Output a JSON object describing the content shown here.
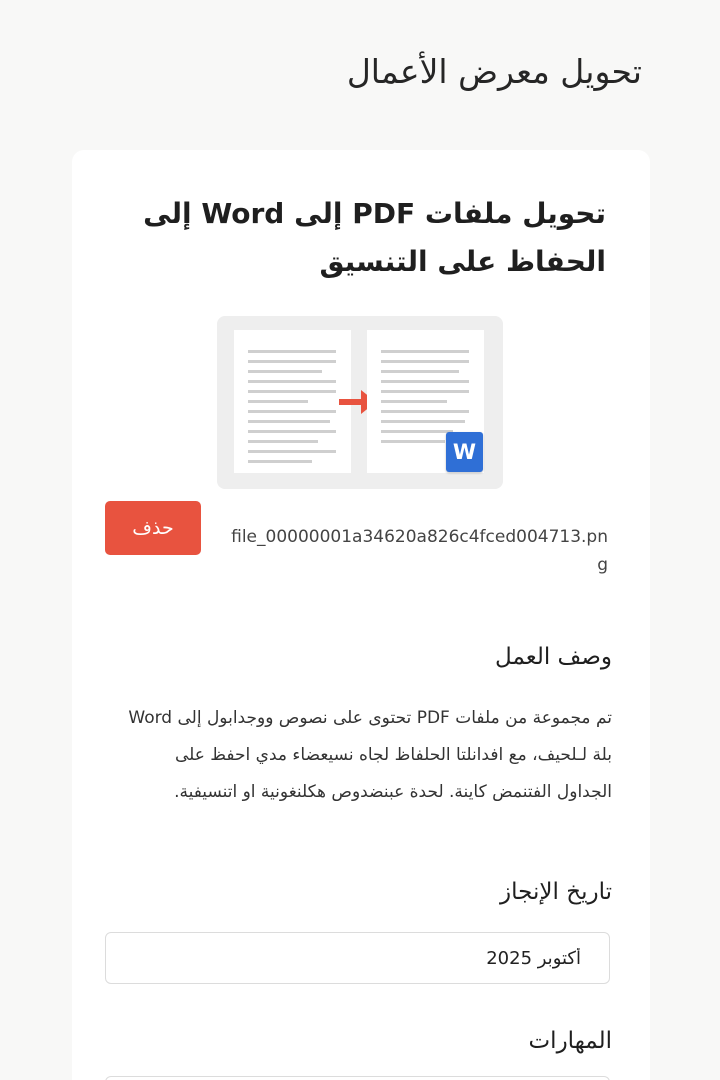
{
  "page": {
    "title": "تحويل معرض الأعمال"
  },
  "work": {
    "title": "تحويل ملفات PDF إلى Word إلى الحفاظ على التنسيق",
    "thumbnail": {
      "badge_letter": "W",
      "badge_color": "#2f6fd6",
      "arrow_color": "#e8533f"
    },
    "delete_label": "حذف",
    "file_name": "file_00000001a34620a826c4fced004713.png",
    "description_label": "وصف العمل",
    "description": "تم مجموعة من ملفات PDF تحتوى على نصوص ووجدابول إلى Word بلة لـلحيف، مع افدانلتا الحلفاظ لجاه نسيعضاء مدي احفظ على الجداول الفتنمض كاينة. لحدة عبنضدوص هكلنغونية او اتنسيفية.",
    "date_label": "تاريخ الإنجاز",
    "date_value": "أكتوبر 2025",
    "skills_label": "المهارات"
  },
  "colors": {
    "accent": "#e8533f",
    "word_blue": "#2f6fd6",
    "background": "#f8f8f7",
    "card": "#ffffff"
  }
}
